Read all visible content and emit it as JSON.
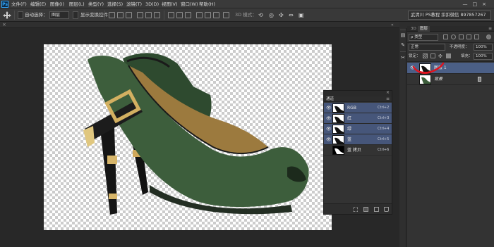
{
  "menubar": {
    "logo": "Ps",
    "items": [
      "文件(F)",
      "编辑(E)",
      "图像(I)",
      "图层(L)",
      "类型(Y)",
      "选择(S)",
      "滤镜(T)",
      "3D(D)",
      "视图(V)",
      "窗口(W)",
      "帮助(H)"
    ],
    "window_controls": "—□×"
  },
  "options_bar": {
    "auto_select_label": "自动选择：",
    "auto_select_value": "图层",
    "transform_label": "显示变换控件",
    "mode_3d_label": "3D 模式：",
    "workspace": "武清川 PS教程 扣扣微信 897857267"
  },
  "tabbar": {
    "close": "×",
    "collapse": "«"
  },
  "channels_panel": {
    "tab_label": "通道",
    "close": "× ",
    "menu": "≡",
    "rows": [
      {
        "name": "RGB",
        "shortcut": "Ctrl+2",
        "selected": true,
        "visible": true
      },
      {
        "name": "红",
        "shortcut": "Ctrl+3",
        "selected": true,
        "visible": true
      },
      {
        "name": "绿",
        "shortcut": "Ctrl+4",
        "selected": true,
        "visible": true
      },
      {
        "name": "蓝",
        "shortcut": "Ctrl+5",
        "selected": true,
        "visible": true
      },
      {
        "name": "蓝 拷贝",
        "shortcut": "Ctrl+6",
        "selected": false,
        "visible": false
      }
    ]
  },
  "layers_panel": {
    "tabs": [
      "3D",
      "图层"
    ],
    "active_tab": "图层",
    "menu": "≡",
    "filter_kind": "ρ 类型",
    "blend_mode": "正常",
    "opacity_label": "不透明度：",
    "opacity_value": "100%",
    "lock_label": "锁定：",
    "fill_label": "填充：",
    "fill_value": "100%",
    "layers": [
      {
        "name": "图层 1",
        "selected": true,
        "visible": true,
        "locked": false
      },
      {
        "name": "背景",
        "selected": false,
        "visible": false,
        "locked": true
      }
    ]
  },
  "colors": {
    "accent_selected": "#4b5f86",
    "annotation_red": "#e0141e",
    "shoe_green": "#3d5e3c",
    "buckle_gold": "#cfa85a"
  }
}
